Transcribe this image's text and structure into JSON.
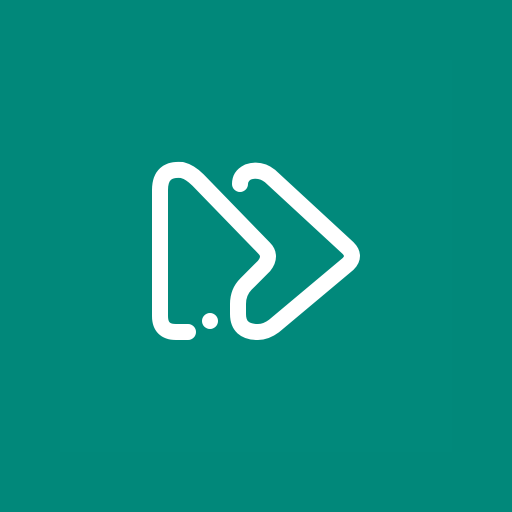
{
  "app": {
    "background_color": "#01887A",
    "tile_color": "#01897B",
    "icon_color": "#FFFFFF",
    "icon_name": "fast-forward-icon"
  }
}
